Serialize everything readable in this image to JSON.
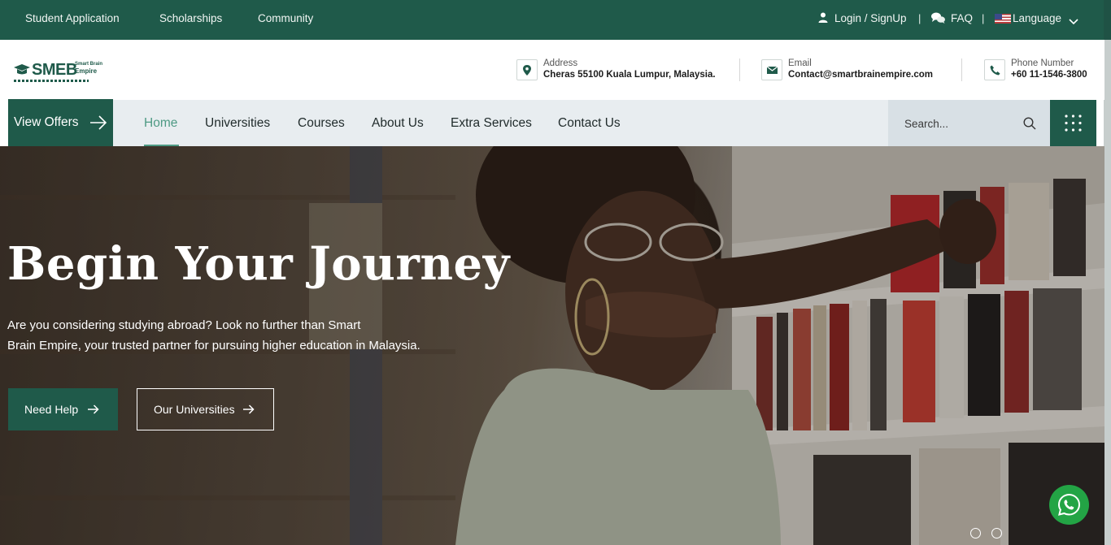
{
  "topbar": {
    "links": [
      "Student Application",
      "Scholarships",
      "Community"
    ],
    "login": "Login / SignUp",
    "faq": "FAQ",
    "language": "Language",
    "separator": "|"
  },
  "header": {
    "logo": {
      "main": "SMEB",
      "line1": "Smart Brain",
      "line2": "Empire"
    },
    "address": {
      "label": "Address",
      "value": "Cheras 55100 Kuala Lumpur, Malaysia."
    },
    "email": {
      "label": "Email",
      "value": "Contact@smartbrainempire.com"
    },
    "phone": {
      "label": "Phone Number",
      "value": "+60 11-1546-3800"
    }
  },
  "nav": {
    "view_offers": "View Offers",
    "items": [
      "Home",
      "Universities",
      "Courses",
      "About Us",
      "Extra Services",
      "Contact Us"
    ],
    "active": "Home",
    "search_placeholder": "Search..."
  },
  "hero": {
    "title": "Begin Your Journey",
    "desc_line1": "Are you considering studying abroad? Look no further than Smart",
    "desc_line2": "Brain Empire, your trusted partner for pursuing higher education in Malaysia.",
    "btn_help": "Need Help",
    "btn_universities": "Our Universities"
  },
  "colors": {
    "brand": "#1f5a4a",
    "accent": "#4e9a84",
    "whatsapp": "#23a445"
  }
}
